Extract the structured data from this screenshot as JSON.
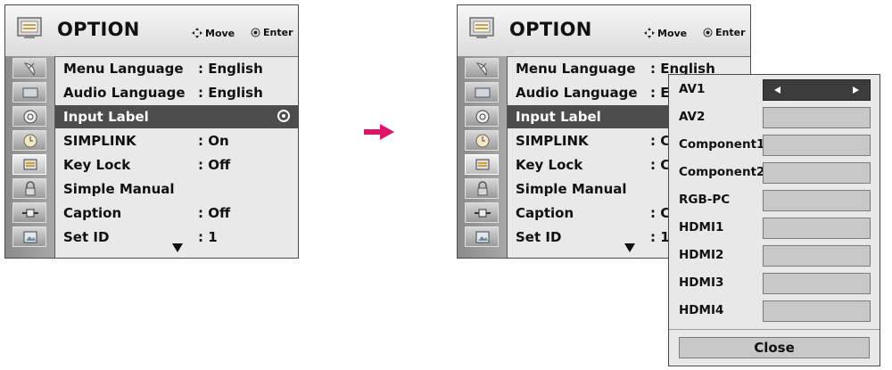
{
  "header": {
    "title": "OPTION",
    "move_label": "Move",
    "enter_label": "Enter",
    "icon": "tv-option-icon"
  },
  "sidebar": {
    "icons": [
      "satellite-dish-icon",
      "picture-icon",
      "audio-disc-icon",
      "clock-icon",
      "option-tv-icon",
      "lock-icon",
      "input-plug-icon",
      "usb-photo-icon"
    ],
    "selected_index": 4
  },
  "left_menu": {
    "items": [
      {
        "label": "Menu Language",
        "value": ": English"
      },
      {
        "label": "Audio Language",
        "value": ": English"
      },
      {
        "label": "Input Label",
        "value": ""
      },
      {
        "label": "SIMPLINK",
        "value": ": On"
      },
      {
        "label": "Key Lock",
        "value": ": Off"
      },
      {
        "label": "Simple Manual",
        "value": ""
      },
      {
        "label": "Caption",
        "value": ": Off"
      },
      {
        "label": "Set ID",
        "value": ": 1"
      }
    ],
    "highlighted_index": 2
  },
  "right_menu": {
    "items": [
      {
        "label": "Menu Language",
        "value": ": English"
      },
      {
        "label": "Audio Language",
        "value": ": E"
      },
      {
        "label": "Input Label",
        "value": ""
      },
      {
        "label": "SIMPLINK",
        "value": ": C"
      },
      {
        "label": "Key Lock",
        "value": ": C"
      },
      {
        "label": "Simple Manual",
        "value": ""
      },
      {
        "label": "Caption",
        "value": ": C"
      },
      {
        "label": "Set ID",
        "value": ": 1"
      }
    ],
    "highlighted_index": 2
  },
  "input_label_popup": {
    "inputs": [
      "AV1",
      "AV2",
      "Component1",
      "Component2",
      "RGB-PC",
      "HDMI1",
      "HDMI2",
      "HDMI3",
      "HDMI4"
    ],
    "active_index": 0,
    "close_label": "Close"
  },
  "colors": {
    "highlight": "#4d4d4d",
    "arrow": "#e0136b",
    "panel_bg": "#e9e9e9"
  }
}
